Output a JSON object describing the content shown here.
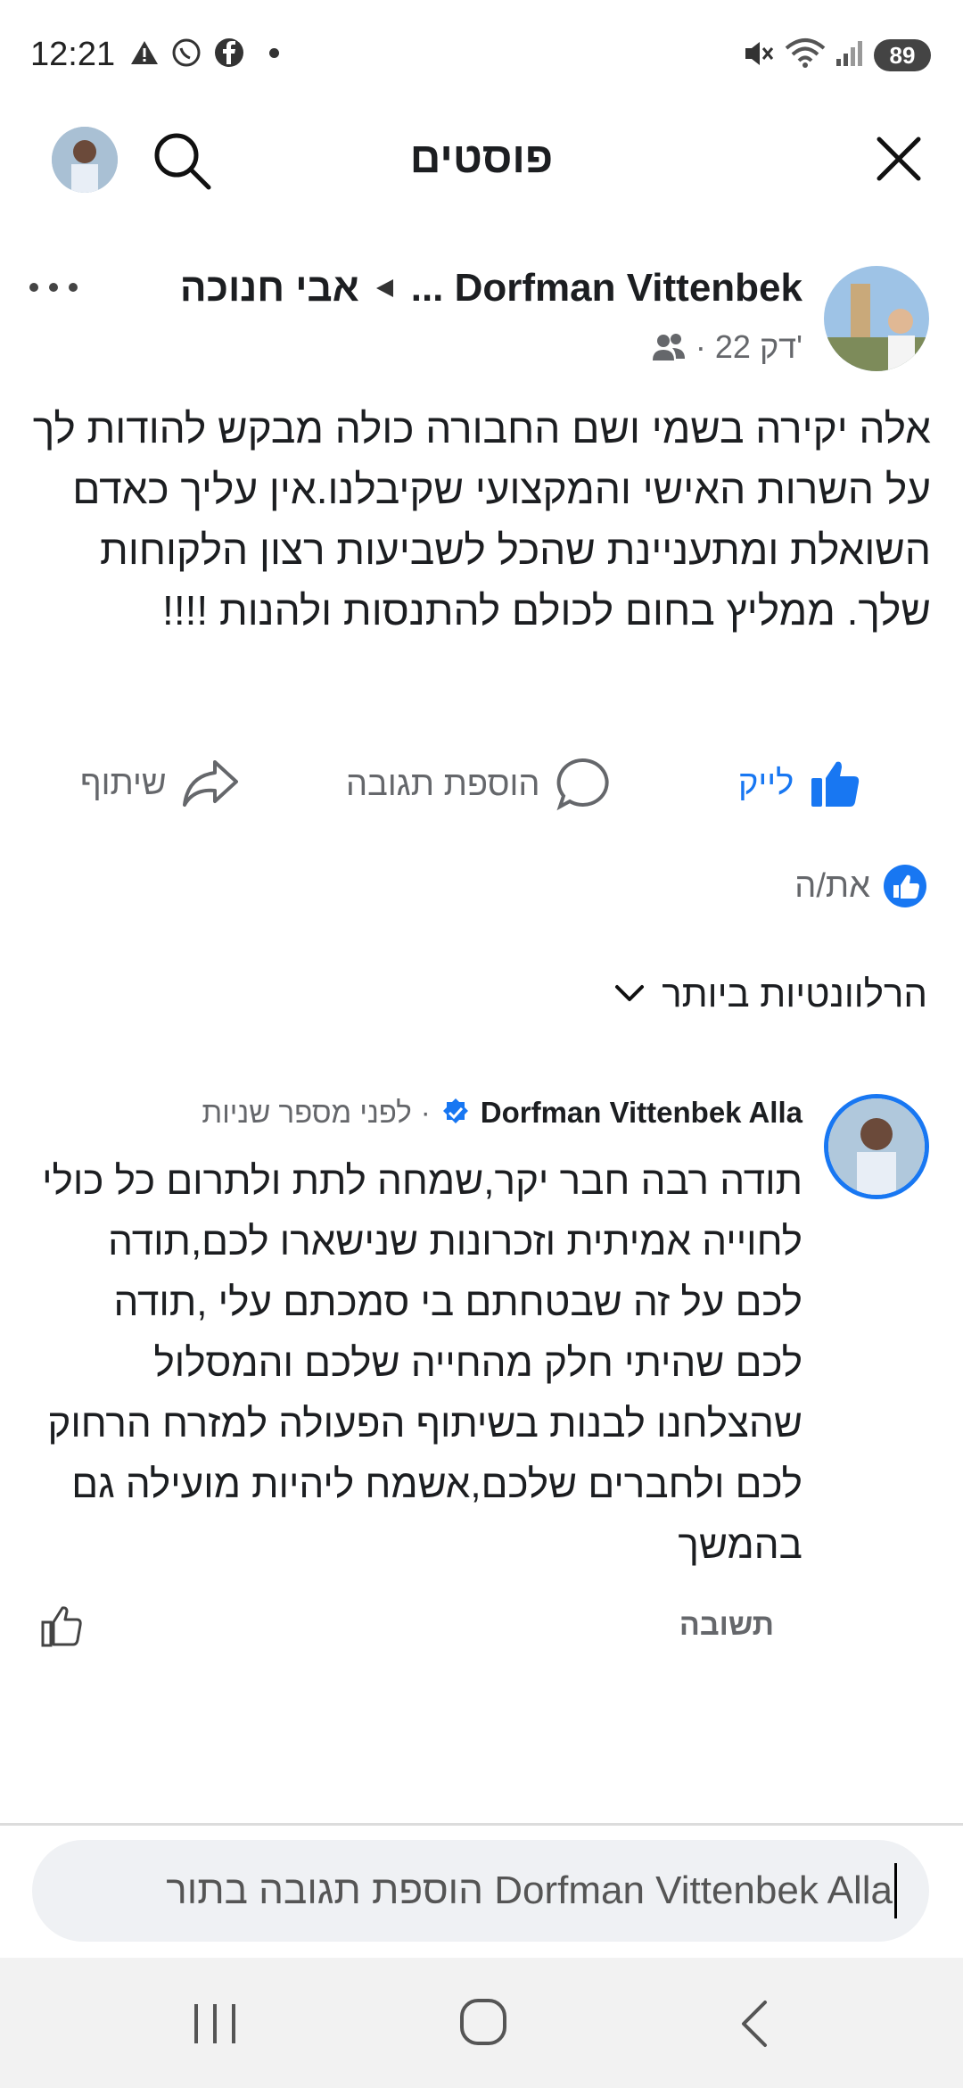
{
  "status_bar": {
    "time": "12:21",
    "left_icons": [
      "warning-icon",
      "whatsapp-icon",
      "facebook-icon",
      "dot-icon"
    ],
    "right_icons": [
      "mute-icon",
      "wifi-icon",
      "signal-icon"
    ],
    "battery": "89"
  },
  "header": {
    "title": "פוסטים"
  },
  "post": {
    "author": "... Dorfman Vittenbek",
    "group": "אבי חנוכה",
    "time": "22 דק'",
    "separator": "·",
    "text": "אלה יקירה בשמי ושם החבורה כולה מבקש להודות לך על השרות האישי והמקצועי שקיבלנו.אין עליך כאדם השואלת ומתעניינת שהכל לשביעות רצון הלקוחות שלך.  ממליץ בחום לכולם להתנסות ולהנות !!!!"
  },
  "actions": {
    "like": "לייק",
    "comment": "הוספת תגובה",
    "share": "שיתוף"
  },
  "reactions": {
    "label": "את/ה"
  },
  "comments_sort": {
    "label": "הרלוונטיות ביותר"
  },
  "comment": {
    "author": "Dorfman Vittenbek Alla",
    "time": "לפני מספר שניות",
    "separator": "·",
    "text": "תודה רבה חבר יקר,שמחה לתת ולתרום כל כולי לחוייה אמיתית וזכרונות שנישארו לכם,תודה לכם על זה שבטחתם בי סמכתם עלי ,תודה לכם שהיתי חלק מהחייה שלכם והמסלול שהצלחנו לבנות בשיתוף הפעולה למזרח הרחוק לכם ולחברים שלכם,אשמח ליהיות מועילה גם בהמשך",
    "reply": "תשובה"
  },
  "reply_input": {
    "value": "הוספת תגובה בתור Dorfman Vittenbek Alla"
  },
  "colors": {
    "accent": "#1877f2",
    "text": "#1c1e21",
    "muted": "#65676b"
  }
}
